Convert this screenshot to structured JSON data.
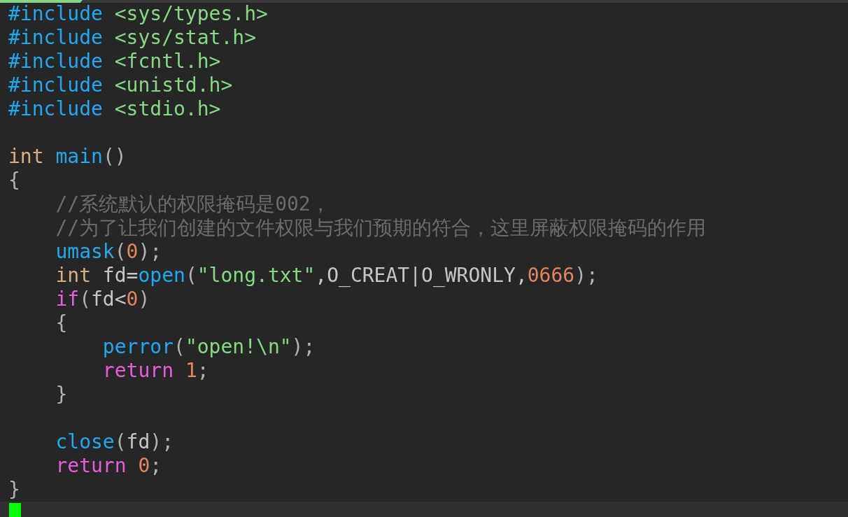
{
  "editor": {
    "lines": [
      {
        "kind": "code",
        "tokens": [
          {
            "kind": "preproc",
            "text": "#include "
          },
          {
            "kind": "header",
            "text": "<sys/types.h>"
          }
        ]
      },
      {
        "kind": "code",
        "tokens": [
          {
            "kind": "preproc",
            "text": "#include "
          },
          {
            "kind": "header",
            "text": "<sys/stat.h>"
          }
        ]
      },
      {
        "kind": "code",
        "tokens": [
          {
            "kind": "preproc",
            "text": "#include "
          },
          {
            "kind": "header",
            "text": "<fcntl.h>"
          }
        ]
      },
      {
        "kind": "code",
        "tokens": [
          {
            "kind": "preproc",
            "text": "#include "
          },
          {
            "kind": "header",
            "text": "<unistd.h>"
          }
        ]
      },
      {
        "kind": "code",
        "tokens": [
          {
            "kind": "preproc",
            "text": "#include "
          },
          {
            "kind": "header",
            "text": "<stdio.h>"
          }
        ]
      },
      {
        "kind": "blank"
      },
      {
        "kind": "code",
        "tokens": [
          {
            "kind": "type",
            "text": "int "
          },
          {
            "kind": "func",
            "text": "main"
          },
          {
            "kind": "punct",
            "text": "()"
          }
        ]
      },
      {
        "kind": "code",
        "tokens": [
          {
            "kind": "punct",
            "text": "{"
          }
        ]
      },
      {
        "kind": "comment",
        "tokens": [
          {
            "kind": "comment",
            "text": "    //系统默认的权限掩码是002，"
          }
        ]
      },
      {
        "kind": "comment",
        "tokens": [
          {
            "kind": "comment",
            "text": "    //为了让我们创建的文件权限与我们预期的符合，这里屏蔽权限掩码的作用"
          }
        ]
      },
      {
        "kind": "code",
        "tokens": [
          {
            "kind": "func",
            "text": "    umask"
          },
          {
            "kind": "punct",
            "text": "("
          },
          {
            "kind": "number",
            "text": "0"
          },
          {
            "kind": "punct",
            "text": ");"
          }
        ]
      },
      {
        "kind": "code",
        "tokens": [
          {
            "kind": "type",
            "text": "    int "
          },
          {
            "kind": "plain",
            "text": "fd="
          },
          {
            "kind": "func",
            "text": "open"
          },
          {
            "kind": "punct",
            "text": "("
          },
          {
            "kind": "string",
            "text": "\"long.txt\""
          },
          {
            "kind": "plain",
            "text": ",O_CREAT|O_WRONLY,"
          },
          {
            "kind": "number",
            "text": "0666"
          },
          {
            "kind": "punct",
            "text": ");"
          }
        ]
      },
      {
        "kind": "code",
        "tokens": [
          {
            "kind": "keyword",
            "text": "    if"
          },
          {
            "kind": "punct",
            "text": "("
          },
          {
            "kind": "plain",
            "text": "fd<"
          },
          {
            "kind": "number",
            "text": "0"
          },
          {
            "kind": "punct",
            "text": ")"
          }
        ]
      },
      {
        "kind": "code",
        "tokens": [
          {
            "kind": "punct",
            "text": "    {"
          }
        ]
      },
      {
        "kind": "code",
        "tokens": [
          {
            "kind": "func",
            "text": "        perror"
          },
          {
            "kind": "punct",
            "text": "("
          },
          {
            "kind": "string",
            "text": "\"open!\\n\""
          },
          {
            "kind": "punct",
            "text": ");"
          }
        ]
      },
      {
        "kind": "code",
        "tokens": [
          {
            "kind": "keyword",
            "text": "        return "
          },
          {
            "kind": "number",
            "text": "1"
          },
          {
            "kind": "punct",
            "text": ";"
          }
        ]
      },
      {
        "kind": "code",
        "tokens": [
          {
            "kind": "punct",
            "text": "    }"
          }
        ]
      },
      {
        "kind": "blank"
      },
      {
        "kind": "code",
        "tokens": [
          {
            "kind": "func",
            "text": "    close"
          },
          {
            "kind": "punct",
            "text": "("
          },
          {
            "kind": "plain",
            "text": "fd"
          },
          {
            "kind": "punct",
            "text": ");"
          }
        ]
      },
      {
        "kind": "code",
        "tokens": [
          {
            "kind": "keyword",
            "text": "    return "
          },
          {
            "kind": "number",
            "text": "0"
          },
          {
            "kind": "punct",
            "text": ";"
          }
        ]
      },
      {
        "kind": "code",
        "tokens": [
          {
            "kind": "punct",
            "text": "}"
          }
        ]
      },
      {
        "kind": "cursor"
      }
    ]
  }
}
